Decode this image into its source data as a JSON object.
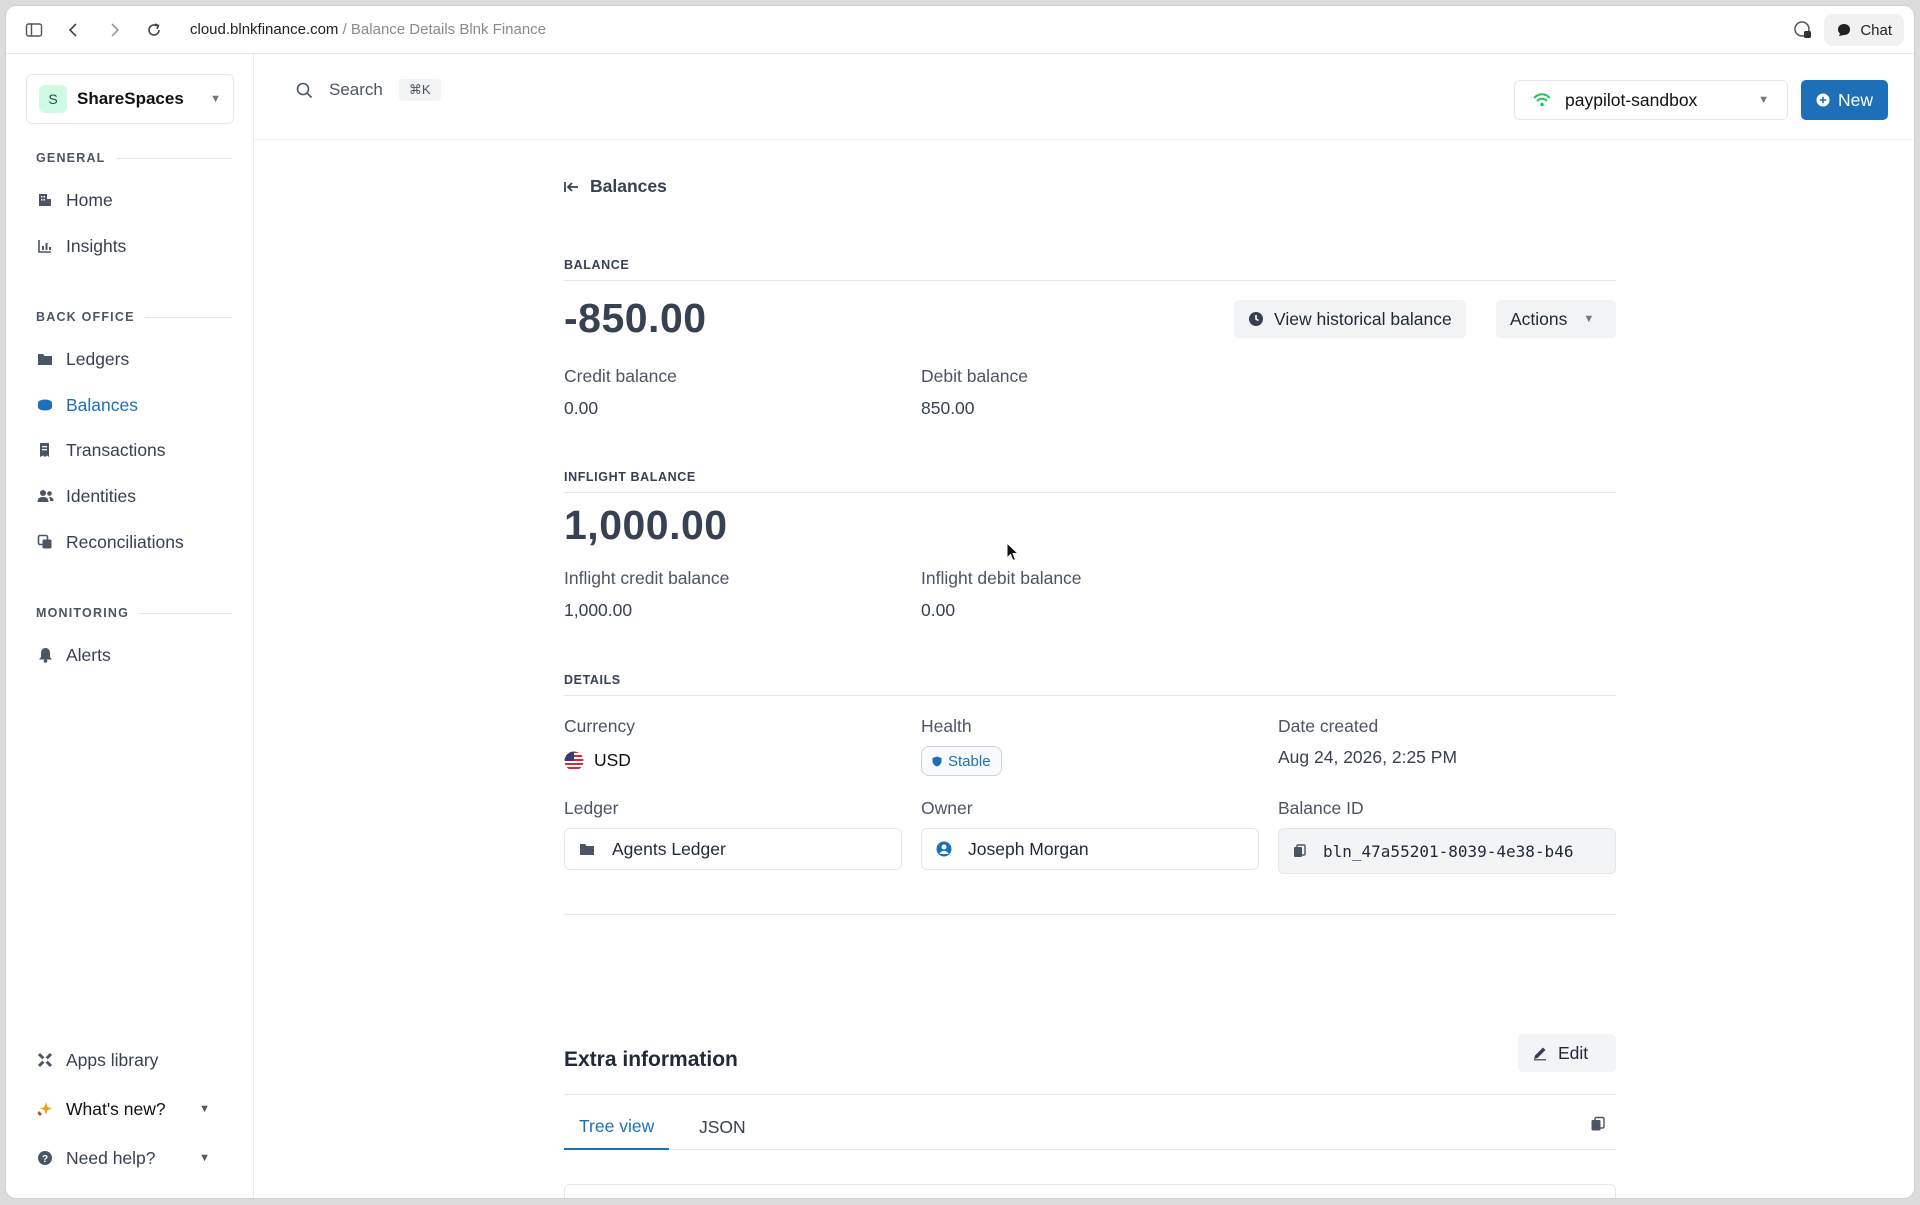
{
  "browser": {
    "url_host": "cloud.blnkfinance.com",
    "url_rest": " / Balance Details Blnk Finance",
    "chat_label": "Chat"
  },
  "sidebar": {
    "workspace": {
      "initial": "S",
      "name": "ShareSpaces"
    },
    "sections": {
      "general": "GENERAL",
      "back_office": "BACK OFFICE",
      "monitoring": "MONITORING"
    },
    "items": [
      {
        "label": "Home",
        "icon": "building-icon"
      },
      {
        "label": "Insights",
        "icon": "chart-icon"
      },
      {
        "label": "Ledgers",
        "icon": "folder-icon"
      },
      {
        "label": "Balances",
        "icon": "coins-icon",
        "active": true
      },
      {
        "label": "Transactions",
        "icon": "receipt-icon"
      },
      {
        "label": "Identities",
        "icon": "users-icon"
      },
      {
        "label": "Reconciliations",
        "icon": "copy-icon"
      },
      {
        "label": "Alerts",
        "icon": "bell-icon"
      }
    ],
    "footer": {
      "apps": "Apps library",
      "whats_new": "What's new?",
      "help": "Need help?"
    }
  },
  "topbar": {
    "search_label": "Search",
    "shortcut": "⌘K",
    "environment": "paypilot-sandbox",
    "new_label": "New"
  },
  "page": {
    "back_label": "Balances",
    "balance": {
      "section": "BALANCE",
      "amount": "-850.00",
      "view_history": "View historical balance",
      "actions": "Actions",
      "credit_label": "Credit balance",
      "credit_value": "0.00",
      "debit_label": "Debit balance",
      "debit_value": "850.00"
    },
    "inflight": {
      "section": "INFLIGHT BALANCE",
      "amount": "1,000.00",
      "credit_label": "Inflight credit balance",
      "credit_value": "1,000.00",
      "debit_label": "Inflight debit balance",
      "debit_value": "0.00"
    },
    "details": {
      "section": "DETAILS",
      "currency_label": "Currency",
      "currency_value": "USD",
      "health_label": "Health",
      "health_value": "Stable",
      "date_label": "Date created",
      "date_value": "Aug 24, 2026, 2:25 PM",
      "ledger_label": "Ledger",
      "ledger_value": "Agents Ledger",
      "owner_label": "Owner",
      "owner_value": "Joseph Morgan",
      "balance_id_label": "Balance ID",
      "balance_id_value": "bln_47a55201-8039-4e38-b46"
    },
    "extra": {
      "title": "Extra information",
      "edit_label": "Edit",
      "tabs": [
        "Tree view",
        "JSON"
      ]
    }
  },
  "colors": {
    "accent": "#1d70b8",
    "env_signal": "#22c55e"
  }
}
